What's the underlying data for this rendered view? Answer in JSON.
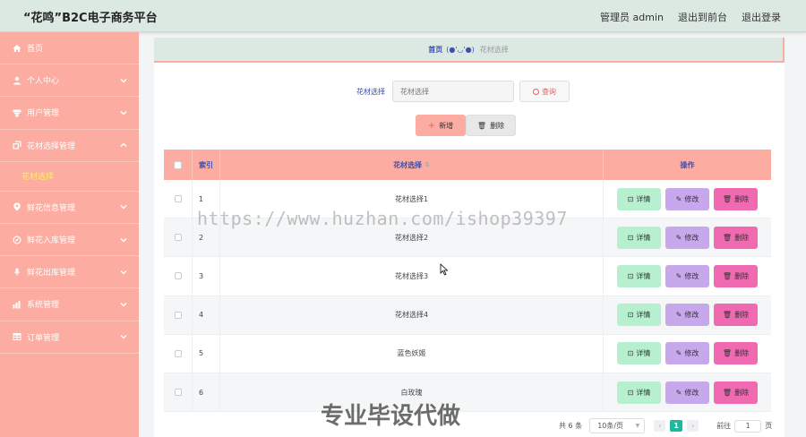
{
  "header": {
    "title": "“花鸣”B2C电子商务平台",
    "links": [
      "管理员 admin",
      "退出到前台",
      "退出登录"
    ]
  },
  "sidebar": {
    "items": [
      {
        "label": "首页",
        "icon": "home-icon",
        "expandable": false
      },
      {
        "label": "个人中心",
        "icon": "user-icon",
        "expandable": true
      },
      {
        "label": "用户管理",
        "icon": "users-icon",
        "expandable": true
      },
      {
        "label": "花材选择管理",
        "icon": "copy-icon",
        "expandable": true,
        "expanded": true
      },
      {
        "label": "鲜花信息管理",
        "icon": "location-icon",
        "expandable": true
      },
      {
        "label": "鲜花入库管理",
        "icon": "compass-icon",
        "expandable": true
      },
      {
        "label": "鲜花出库管理",
        "icon": "mic-icon",
        "expandable": true
      },
      {
        "label": "系统管理",
        "icon": "chart-icon",
        "expandable": true
      },
      {
        "label": "订单管理",
        "icon": "table-icon",
        "expandable": true
      }
    ],
    "active_sub": "花材选择"
  },
  "breadcrumb": {
    "home": "首页",
    "face": "(●'◡'●)",
    "current": "花材选择"
  },
  "search": {
    "label": "花材选择",
    "placeholder": "花材选择",
    "button": "查询"
  },
  "actions": {
    "add": "新增",
    "delete": "删除"
  },
  "table": {
    "headers": {
      "index": "索引",
      "name": "花材选择",
      "ops": "操作"
    },
    "rows": [
      {
        "index": "1",
        "name": "花材选择1"
      },
      {
        "index": "2",
        "name": "花材选择2"
      },
      {
        "index": "3",
        "name": "花材选择3"
      },
      {
        "index": "4",
        "name": "花材选择4"
      },
      {
        "index": "5",
        "name": "蓝色妖姬"
      },
      {
        "index": "6",
        "name": "白玫瑰"
      }
    ],
    "op_labels": {
      "detail": "详情",
      "edit": "修改",
      "delete": "删除"
    }
  },
  "pagination": {
    "total": "共 6 条",
    "page_size": "10条/页",
    "current_page": "1",
    "goto_label": "前往",
    "goto_value": "1",
    "unit": "页"
  },
  "watermarks": {
    "url": "https://www.huzhan.com/ishop39397",
    "text": "专业毕设代做"
  },
  "colors": {
    "sidebar": "#fcaca0",
    "header": "#dce9e3",
    "accent": "#1fb89a",
    "detail": "#b6f0cf",
    "edit": "#c8a8ec",
    "delete": "#f06ab2"
  }
}
